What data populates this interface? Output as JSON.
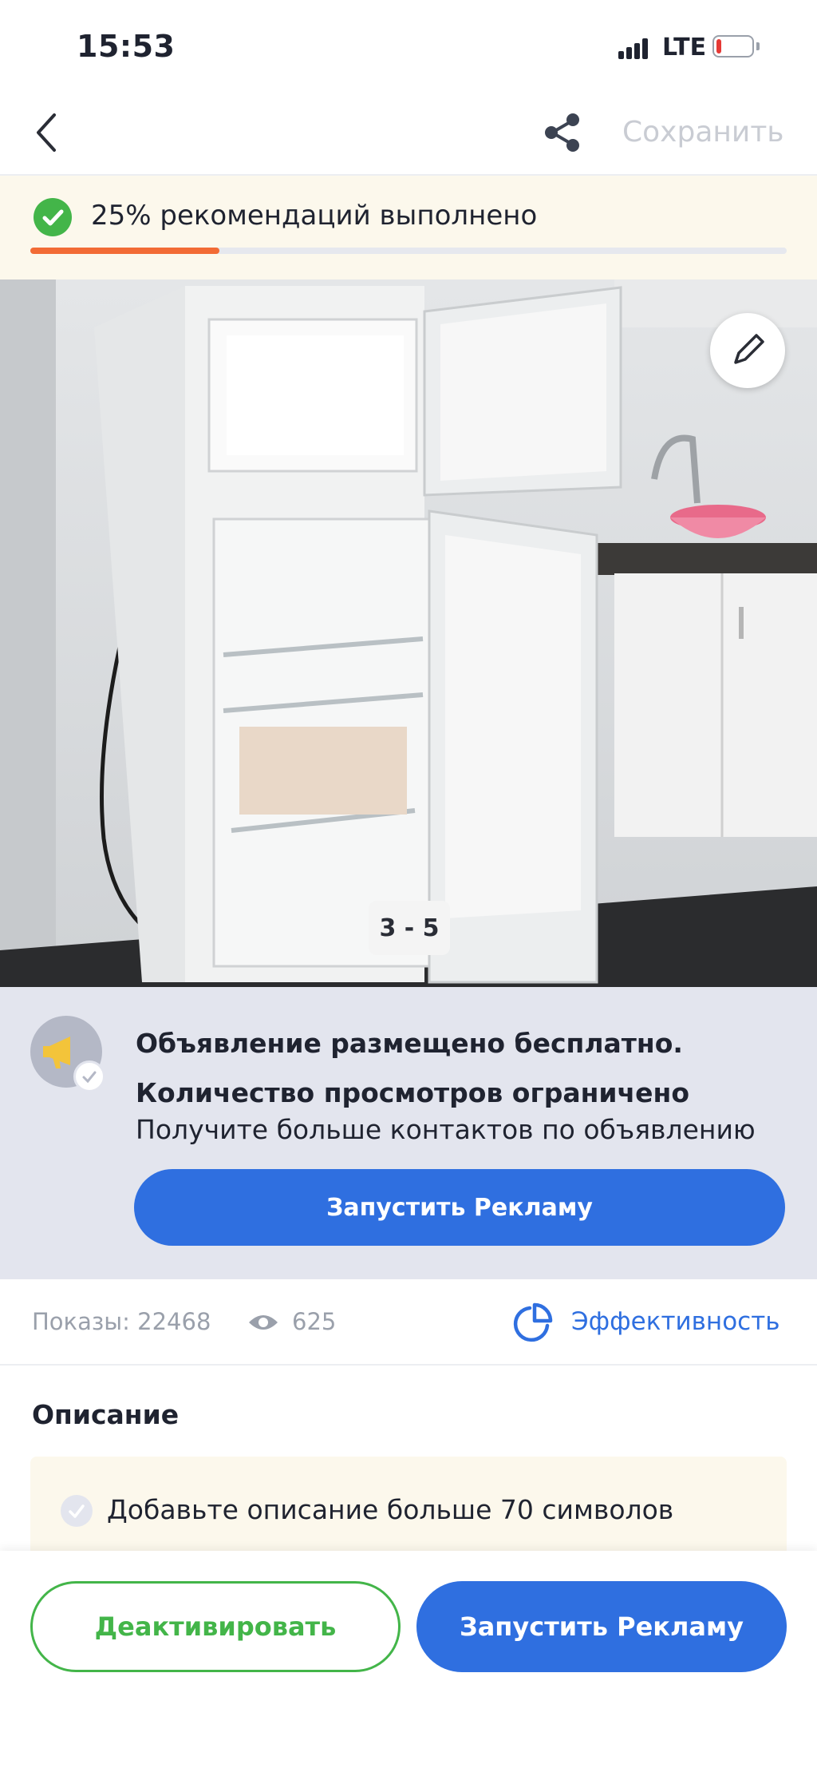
{
  "status_bar": {
    "time": "15:53",
    "network": "LTE",
    "battery_level": 0.15,
    "battery_color": "#e53935"
  },
  "nav": {
    "back_icon": "chevron-left-icon",
    "share_icon": "share-icon",
    "save_label": "Сохранить"
  },
  "recommendations": {
    "text": "25% рекомендаций выполнено",
    "progress": 0.25,
    "progress_color": "#f26b35"
  },
  "photo": {
    "counter": "3 - 5",
    "edit_icon": "pencil-icon"
  },
  "promo": {
    "title_line1": "Объявление размещено бесплатно.",
    "title_line2": "Количество просмотров ограничено",
    "subtitle": "Получите больше контактов по объявлению",
    "button_label": "Запустить Рекламу",
    "icon": "megaphone-icon"
  },
  "stats": {
    "shows_label": "Показы: 22468",
    "views": "625",
    "efficiency_label": "Эффективность"
  },
  "description": {
    "title": "Описание",
    "hint": "Добавьте описание больше 70 символов"
  },
  "bottom_bar": {
    "deactivate_label": "Деактивировать",
    "promote_label": "Запустить Рекламу"
  },
  "colors": {
    "accent_blue": "#2f6fe0",
    "accent_green": "#43b549",
    "banner_bg": "#fcf8ec"
  }
}
